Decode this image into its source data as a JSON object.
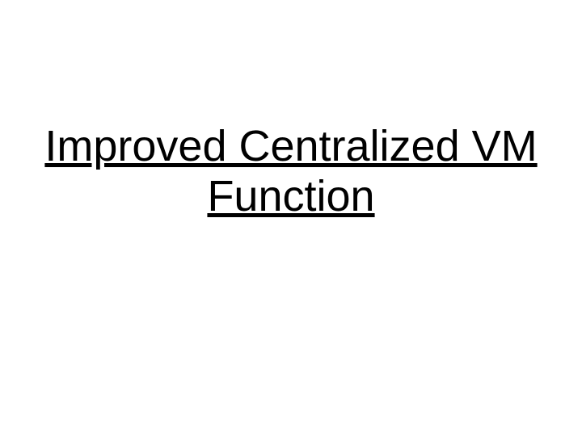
{
  "slide": {
    "title": "Improved Centralized VM Function"
  }
}
